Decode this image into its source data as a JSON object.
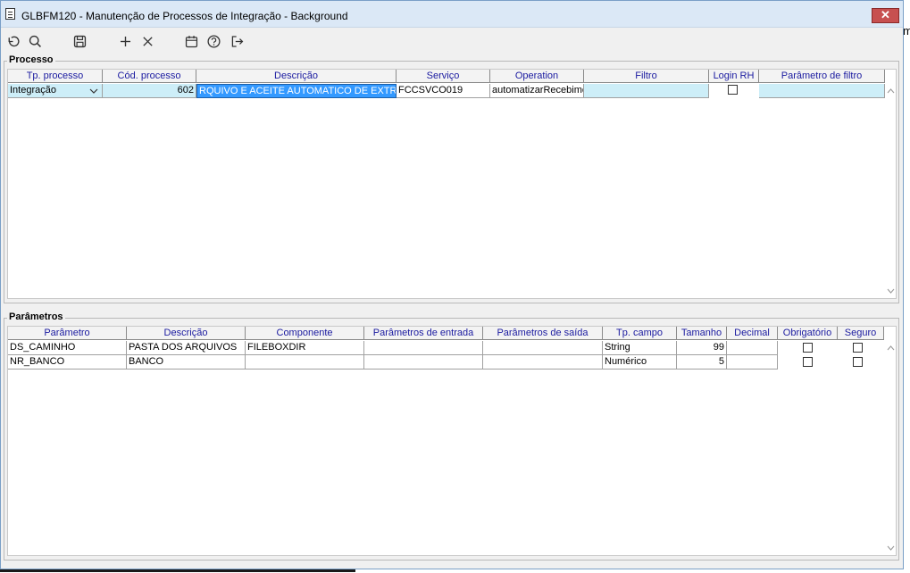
{
  "window": {
    "title": "GLBFM120 - Manutenção de Processos de Integração - Background",
    "close_label": "✕",
    "edge_text": "m"
  },
  "toolbar": {
    "icons": [
      "undo-icon",
      "search-icon",
      "save-icon",
      "add-icon",
      "delete-icon",
      "calendar-icon",
      "help-icon",
      "exit-icon"
    ]
  },
  "processo": {
    "label": "Processo",
    "columns": [
      "Tp. processo",
      "Cód. processo",
      "Descrição",
      "Serviço",
      "Operation",
      "Filtro",
      "Login  RH",
      "Parâmetro de filtro"
    ],
    "rows": [
      {
        "tp_processo": "Integração",
        "cod_processo": "602",
        "descricao": "RQUIVO E ACEITE AUTOMATICO DE EXTRATO",
        "servico": "FCCSVCO019",
        "operation": "automatizarRecebime",
        "filtro": "",
        "login_rh": false,
        "parametro_filtro": ""
      }
    ]
  },
  "parametros": {
    "label": "Parâmetros",
    "columns": [
      "Parâmetro",
      "Descrição",
      "Componente",
      "Parâmetros de entrada",
      "Parâmetros de saída",
      "Tp. campo",
      "Tamanho",
      "Decimal",
      "Obrigatório",
      "Seguro"
    ],
    "rows": [
      {
        "parametro": "DS_CAMINHO",
        "descricao": "PASTA DOS ARQUIVOS",
        "componente": "FILEBOXDIR",
        "entrada": "",
        "saida": "",
        "tp_campo": "String",
        "tamanho": "99",
        "decimal": "",
        "obrigatorio": false,
        "seguro": false
      },
      {
        "parametro": "NR_BANCO",
        "descricao": "BANCO",
        "componente": "",
        "entrada": "",
        "saida": "",
        "tp_campo": "Numérico",
        "tamanho": "5",
        "decimal": "",
        "obrigatorio": false,
        "seguro": false
      }
    ]
  }
}
